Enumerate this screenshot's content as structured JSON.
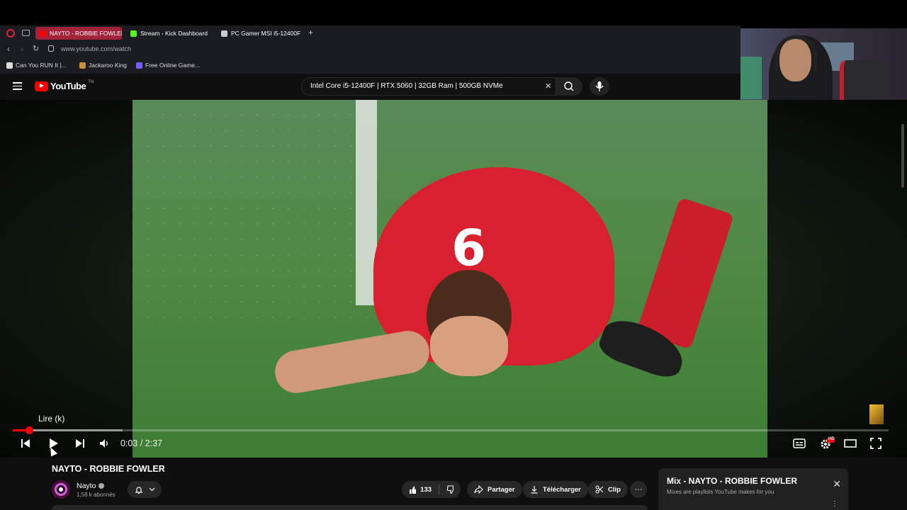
{
  "browser": {
    "tabs": [
      {
        "label": "NAYTO - ROBBIE FOWLER",
        "active": true,
        "favicon_color": "#ff0000"
      },
      {
        "label": "Stream - Kick Dashboard",
        "active": false,
        "favicon_color": "#53fc18"
      },
      {
        "label": "PC Gamer MSI i5-12400F",
        "active": false,
        "favicon_color": "#cccccc"
      }
    ],
    "new_tab": "+",
    "url": "www.youtube.com/watch",
    "bookmarks": [
      {
        "label": "Can You RUN It |...",
        "icon": "canyourunit-icon"
      },
      {
        "label": "Jackaroo King",
        "icon": "jackaroo-icon"
      },
      {
        "label": "Free Online Game...",
        "icon": "game-icon"
      }
    ]
  },
  "youtube": {
    "logo_text": "YouTube",
    "logo_region": "TN",
    "search_value": "Intel Core i5-12400F | RTX 5060 | 32GB Ram | 500GB NVMe"
  },
  "player": {
    "tooltip": "Lire (k)",
    "current_time": "0:03",
    "separator": "/",
    "duration": "2:37",
    "progress_fraction": 0.019,
    "buffer_fraction": 0.125,
    "quality_badge": "HD"
  },
  "video": {
    "title": "NAYTO - ROBBIE FOWLER",
    "channel": "Nayto",
    "subscribers": "1,58 k abonnés",
    "likes": "133",
    "share_label": "Partager",
    "download_label": "Télécharger",
    "clip_label": "Clip",
    "more_label": "···"
  },
  "mix": {
    "title": "Mix - NAYTO - ROBBIE FOWLER",
    "subtitle": "Mixes are playlists YouTube makes for you"
  },
  "colors": {
    "accent": "#ff0000",
    "tab_active": "#a3243a",
    "background": "#0f0f0f"
  }
}
